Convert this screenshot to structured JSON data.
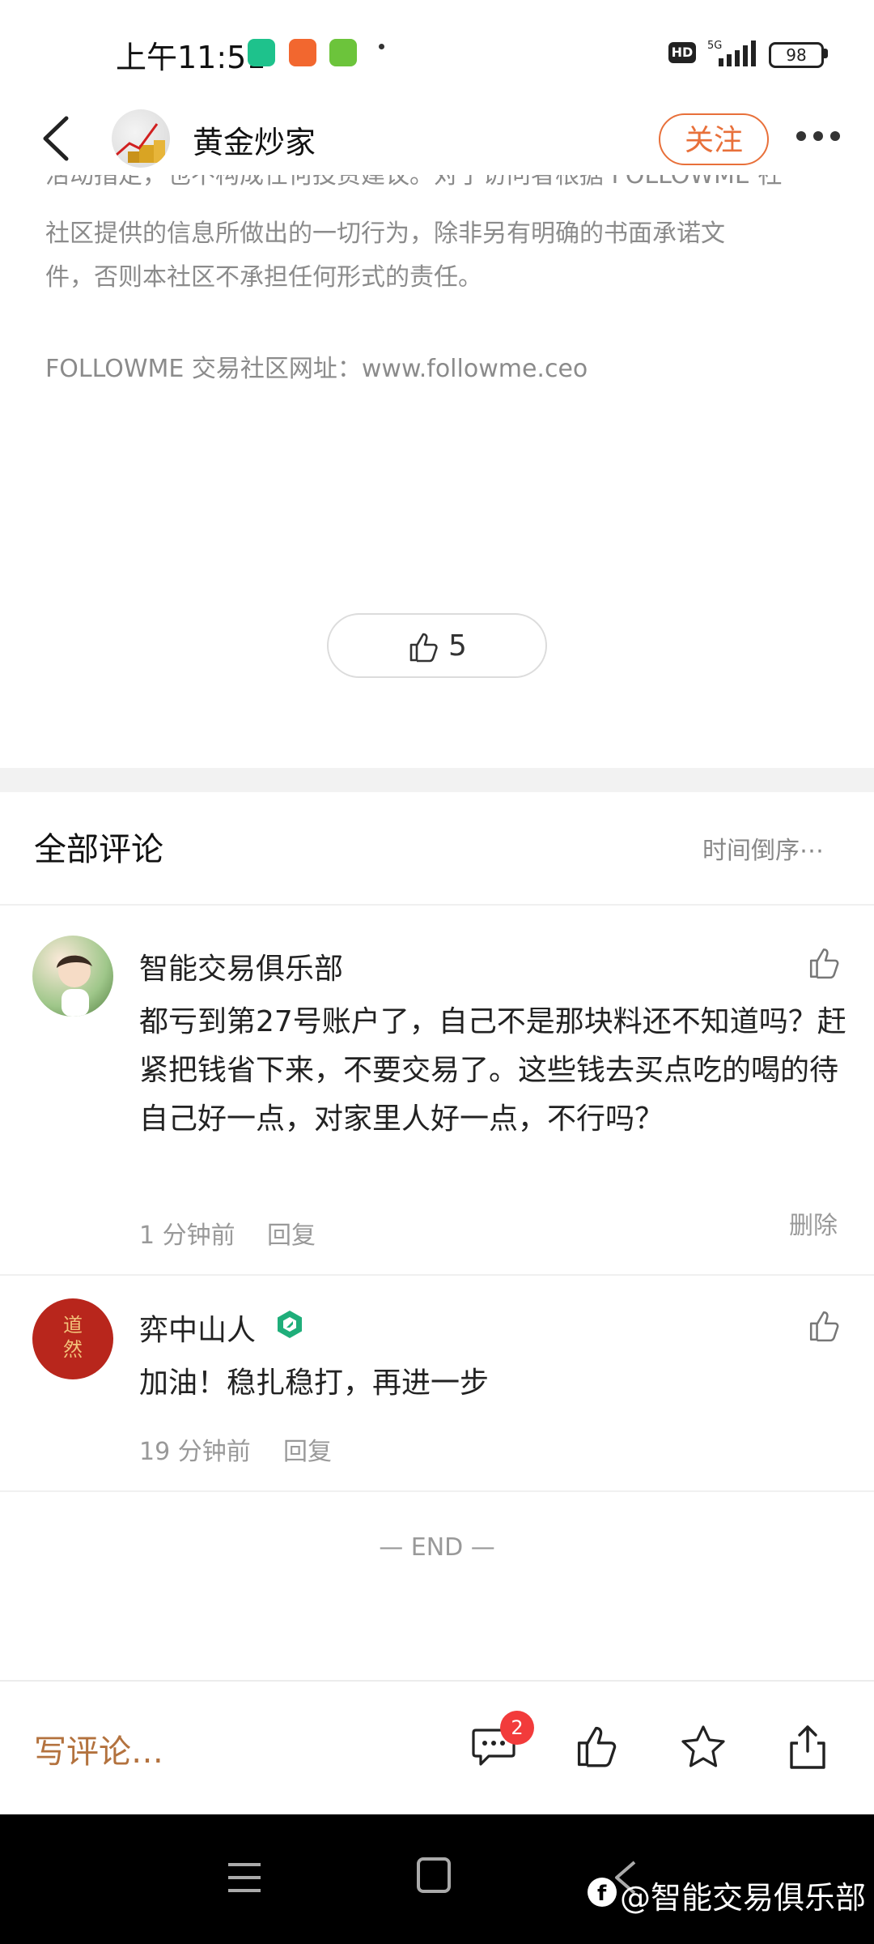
{
  "status_bar": {
    "time": "上午11:51",
    "hd_label": "HD",
    "network": "5G",
    "battery": "98",
    "app_icon_colors": [
      "#1ec28c",
      "#f2672f",
      "#6cc43b"
    ]
  },
  "header": {
    "title": "黄金炒家",
    "follow_label": "关注",
    "accent_color": "#e8703a"
  },
  "article": {
    "partial_line": "活动指定，也不构成任何投资建议。对于访问者根据 FOLLOWME 社",
    "disclaimer_line1": "社区提供的信息所做出的一切行为，除非另有明确的书面承诺文",
    "disclaimer_line2": "件，否则本社区不承担任何形式的责任。",
    "site_line": "FOLLOWME 交易社区网址：www.followme.ceo",
    "like_count": "5"
  },
  "comments": {
    "title": "全部评论",
    "sort_label": "时间倒序⋯",
    "items": [
      {
        "name": "智能交易俱乐部",
        "text": "都亏到第27号账户了，自己不是那块料还不知道吗？赶紧把钱省下来，不要交易了。这些钱去买点吃的喝的待自己好一点，对家里人好一点，不行吗？",
        "time": "1 分钟前",
        "reply": "回复",
        "delete": "删除"
      },
      {
        "name": "弈中山人",
        "text": "加油！稳扎稳打，再进一步",
        "time": "19 分钟前",
        "reply": "回复",
        "avatar_text": "道然"
      }
    ],
    "end_label": "— END —"
  },
  "bottom_bar": {
    "write_placeholder": "写评论…",
    "comment_badge": "2",
    "icons": [
      "comment-icon",
      "like-icon",
      "star-icon",
      "share-icon"
    ]
  },
  "nav_bar": {
    "watermark": "@智能交易俱乐部"
  }
}
